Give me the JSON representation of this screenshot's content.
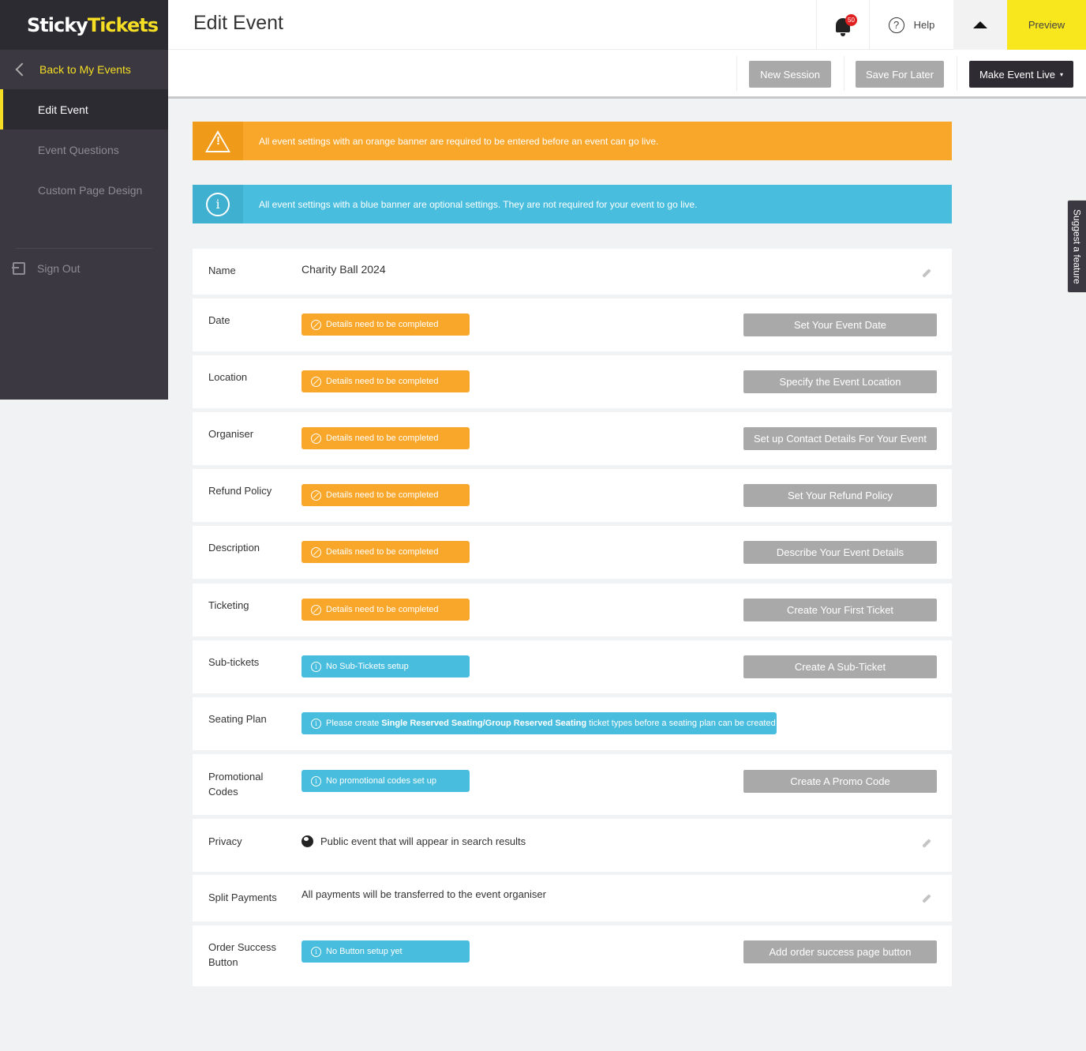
{
  "brand": {
    "logo_part1": "Sticky",
    "logo_part2": "Tickets",
    "accent": "#f5de23",
    "warning": "#f9a72b",
    "info": "#49bddd"
  },
  "sidebar": {
    "back_label": "Back to My Events",
    "items": [
      {
        "label": "Edit Event",
        "active": true
      },
      {
        "label": "Event Questions"
      },
      {
        "label": "Custom Page Design"
      }
    ],
    "signout_label": "Sign Out"
  },
  "header": {
    "title": "Edit Event",
    "notification_count": "50",
    "help_label": "Help",
    "help_glyph": "?",
    "preview_label": "Preview"
  },
  "actions": {
    "new_session": "New Session",
    "save_later": "Save For Later",
    "make_live": "Make Event Live",
    "make_live_caret": "▾"
  },
  "banners": {
    "warning_text": "All event settings with an orange banner are required to be entered before an event can go live.",
    "warning_glyph": "!",
    "info_text": "All event settings with a blue banner are optional settings. They are not required for your event to go live.",
    "info_glyph": "i"
  },
  "pill_glyph": "i",
  "rows": {
    "name": {
      "label": "Name",
      "value": "Charity Ball 2024"
    },
    "date": {
      "label": "Date",
      "status": "Details need to be completed",
      "button": "Set Your Event Date"
    },
    "location": {
      "label": "Location",
      "status": "Details need to be completed",
      "button": "Specify the Event Location"
    },
    "organiser": {
      "label": "Organiser",
      "status": "Details need to be completed",
      "button": "Set up Contact Details For Your Event"
    },
    "refund": {
      "label": "Refund Policy",
      "status": "Details need to be completed",
      "button": "Set Your Refund Policy"
    },
    "description": {
      "label": "Description",
      "status": "Details need to be completed",
      "button": "Describe Your Event Details"
    },
    "ticketing": {
      "label": "Ticketing",
      "status": "Details need to be completed",
      "button": "Create Your First Ticket"
    },
    "subtickets": {
      "label": "Sub-tickets",
      "status": "No Sub-Tickets setup",
      "button": "Create A Sub-Ticket"
    },
    "seating": {
      "label": "Seating Plan",
      "status_pre": "Please create",
      "status_bold": "Single Reserved Seating/Group Reserved Seating",
      "status_post": "ticket types before a seating plan can be created"
    },
    "promo": {
      "label_line1": "Promotional",
      "label_line2": "Codes",
      "status": "No promotional codes set up",
      "button": "Create A Promo Code"
    },
    "privacy": {
      "label": "Privacy",
      "value": "Public event that will appear in search results"
    },
    "split": {
      "label": "Split Payments",
      "value": "All payments will be transferred to the event organiser"
    },
    "order": {
      "label_line1": "Order Success",
      "label_line2": "Button",
      "status": "No Button setup yet",
      "button": "Add order success page button"
    }
  },
  "suggest_label": "Suggest a feature"
}
